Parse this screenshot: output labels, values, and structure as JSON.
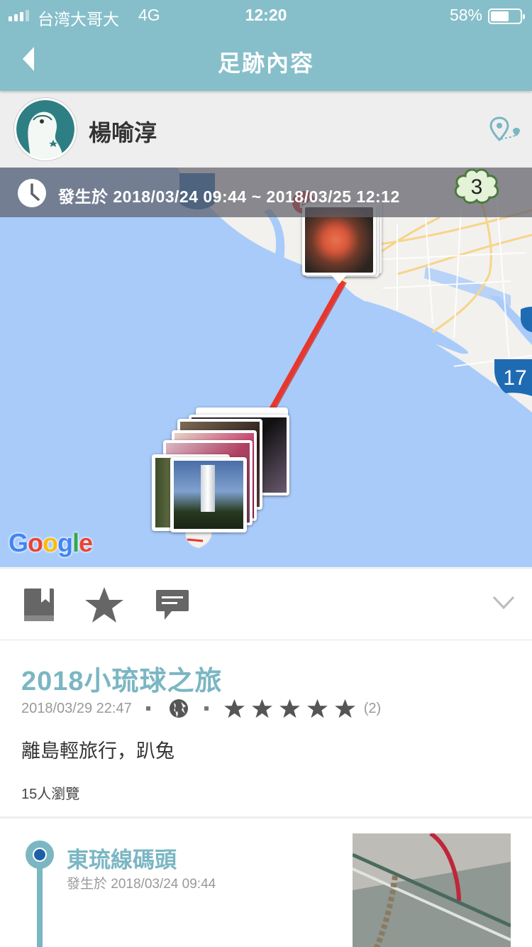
{
  "status_bar": {
    "carrier": "台湾大哥大",
    "network": "4G",
    "time": "12:20",
    "battery": "58%",
    "battery_level": 0.58
  },
  "nav": {
    "title": "足跡內容"
  },
  "user": {
    "name": "楊喻淳"
  },
  "map": {
    "time_range": "發生於 2018/03/24 09:44 ~ 2018/03/25 12:12",
    "cluster_count": "3",
    "highway_label": "17",
    "attribution": "Google",
    "colors": {
      "water": "#a9cbfa",
      "land": "#f2f1ee",
      "route": "#e8362c"
    }
  },
  "post": {
    "title": "2018小琉球之旅",
    "date": "2018/03/29 22:47",
    "rating": 5,
    "rating_count": "(2)",
    "description": "離島輕旅行，趴兔",
    "views": "15人瀏覽"
  },
  "timeline": [
    {
      "title": "東琉線碼頭",
      "time": "發生於 2018/03/24 09:44"
    }
  ],
  "colors": {
    "accent": "#7bb6c3",
    "topbar": "#86bfca"
  }
}
